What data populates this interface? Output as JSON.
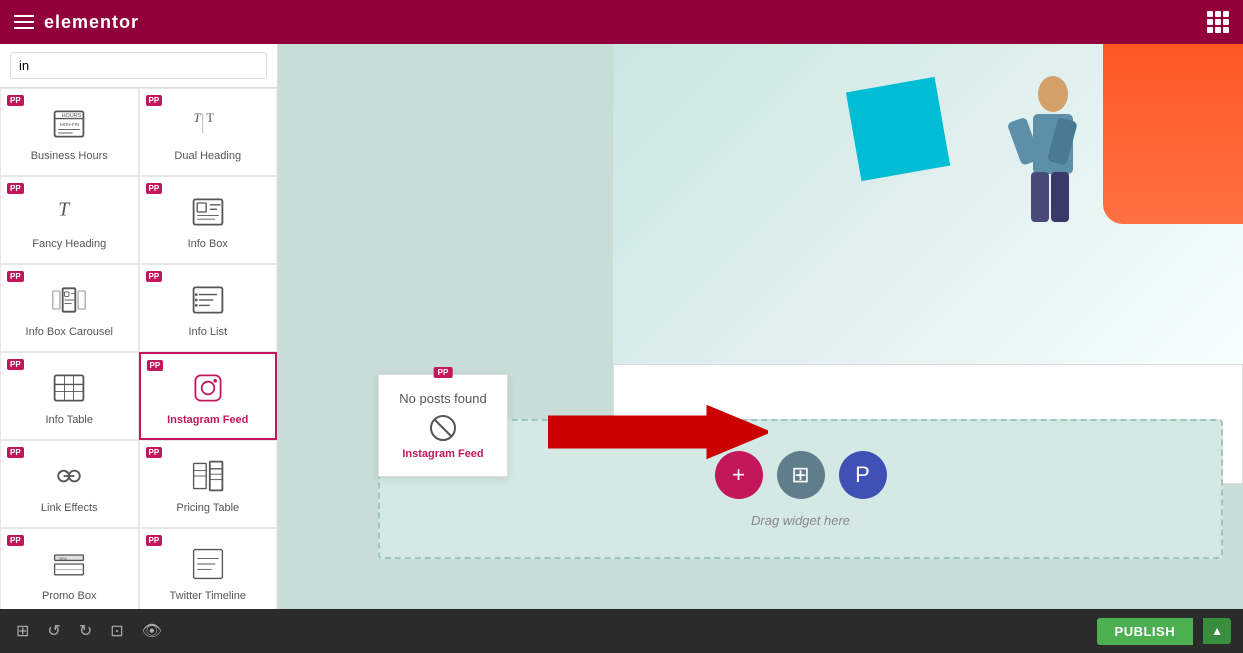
{
  "topbar": {
    "title": "elementor",
    "menu_icon": "hamburger",
    "grid_icon": "grid"
  },
  "search": {
    "placeholder": "in",
    "value": "in"
  },
  "widgets": [
    {
      "id": "business-hours",
      "label": "Business Hours",
      "pp": true,
      "col": 0
    },
    {
      "id": "dual-heading",
      "label": "Dual Heading",
      "pp": true,
      "col": 1
    },
    {
      "id": "fancy-heading",
      "label": "Fancy Heading",
      "pp": true,
      "col": 0
    },
    {
      "id": "info-box",
      "label": "Info Box",
      "pp": true,
      "col": 1
    },
    {
      "id": "info-box-carousel",
      "label": "Info Box Carousel",
      "pp": true,
      "col": 0
    },
    {
      "id": "info-list",
      "label": "Info List",
      "pp": true,
      "col": 1
    },
    {
      "id": "info-table",
      "label": "Info Table",
      "pp": true,
      "col": 0
    },
    {
      "id": "instagram-feed",
      "label": "Instagram Feed",
      "pp": true,
      "highlighted": true,
      "col": 1
    },
    {
      "id": "link-effects",
      "label": "Link Effects",
      "pp": true,
      "col": 0
    },
    {
      "id": "pricing-table",
      "label": "Pricing Table",
      "pp": true,
      "col": 1
    },
    {
      "id": "promo-box",
      "label": "Promo Box",
      "pp": true,
      "col": 0
    },
    {
      "id": "twitter-timeline",
      "label": "Twitter Timeline",
      "pp": true,
      "col": 1
    }
  ],
  "canvas": {
    "no_posts_text": "No posts found",
    "no_posts_label": "Instagram Feed",
    "drag_text": "Drag widget here"
  },
  "bottombar": {
    "publish_label": "PUBLISH"
  }
}
